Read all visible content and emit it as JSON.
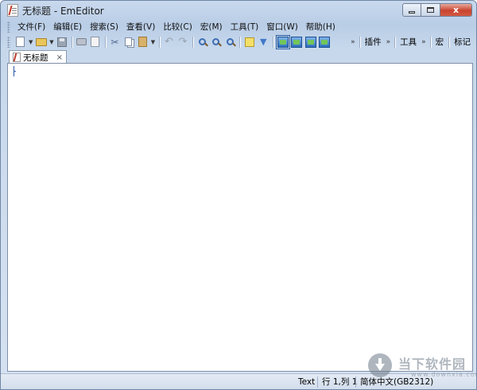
{
  "window": {
    "title": "无标题 - EmEditor",
    "minimize_label": "",
    "maximize_label": "",
    "close_label": "x"
  },
  "menu": {
    "items": [
      "文件(F)",
      "编辑(E)",
      "搜索(S)",
      "查看(V)",
      "比较(C)",
      "宏(M)",
      "工具(T)",
      "窗口(W)",
      "帮助(H)"
    ]
  },
  "toolbar": {
    "icons": [
      "new-file",
      "open-file",
      "save",
      "print",
      "print-preview",
      "cut",
      "copy",
      "paste",
      "undo",
      "redo",
      "find",
      "find-next",
      "find-previous",
      "highlight",
      "filter",
      "view-1",
      "view-2",
      "view-3",
      "view-4"
    ],
    "overflow_chevron": "»",
    "plugins_label": "插件",
    "tools_label": "工具",
    "macros_label": "宏",
    "marker_label": "标记"
  },
  "tabs": [
    {
      "label": "无标题",
      "close": "×",
      "active": true
    }
  ],
  "editor": {
    "content": ""
  },
  "statusbar": {
    "mode": "Text",
    "position": "行 1,列 1",
    "encoding": "简体中文(GB2312)"
  },
  "watermark": {
    "name": "当下软件园",
    "url": "www.downxia.com"
  },
  "colors": {
    "frame": "#c9d9ee",
    "close_button": "#c8442f",
    "caret": "#2a5aa8"
  }
}
